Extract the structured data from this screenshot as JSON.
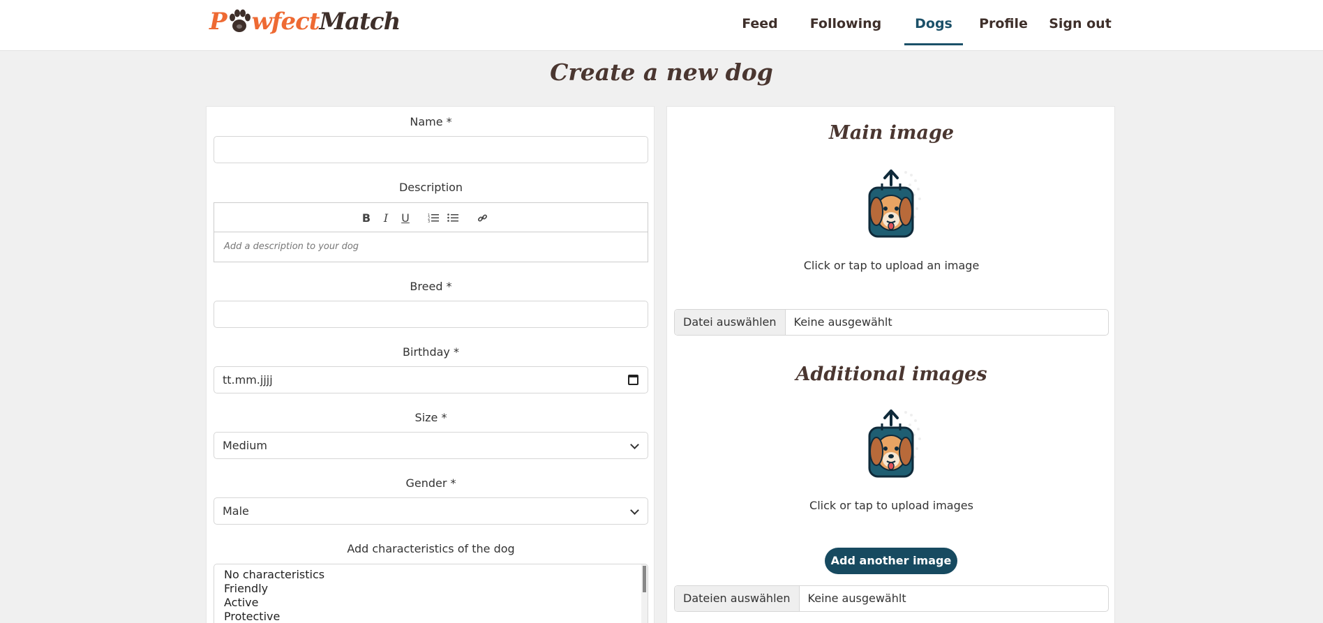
{
  "brand": {
    "p": "P",
    "after_paw": "wfect",
    "match": "Match"
  },
  "nav": {
    "feed": "Feed",
    "following": "Following",
    "dogs": "Dogs",
    "profile": "Profile",
    "signout": "Sign out",
    "active": "Dogs"
  },
  "page": {
    "title": "Create a new dog"
  },
  "form": {
    "name_label": "Name *",
    "name_value": "",
    "description_label": "Description",
    "description_placeholder": "Add a description to your dog",
    "toolbar": {
      "bold": "B",
      "italic": "I",
      "underline": "U"
    },
    "breed_label": "Breed *",
    "breed_value": "",
    "birthday_label": "Birthday *",
    "birthday_placeholder": "tt.mm.jjjj",
    "size_label": "Size *",
    "size_value": "Medium",
    "gender_label": "Gender *",
    "gender_value": "Male",
    "characteristics_label": "Add characteristics of the dog",
    "characteristics": [
      "No characteristics",
      "Friendly",
      "Active",
      "Protective"
    ]
  },
  "main_image": {
    "title": "Main image",
    "hint": "Click or tap to upload an image",
    "file_button": "Datei auswählen",
    "file_status": "Keine ausgewählt"
  },
  "additional_images": {
    "title": "Additional images",
    "hint": "Click or tap to upload images",
    "add_button": "Add another image",
    "file_button": "Dateien auswählen",
    "file_status": "Keine ausgewählt"
  },
  "colors": {
    "brand_orange": "#ee6a33",
    "brand_dark": "#3e2f2a",
    "accent": "#174a60",
    "background": "#f0f0f0"
  },
  "icons": [
    "paw-icon",
    "upload-dog-icon",
    "bold-icon",
    "italic-icon",
    "underline-icon",
    "ordered-list-icon",
    "bullet-list-icon",
    "link-icon",
    "calendar-icon",
    "chevron-down-icon"
  ]
}
